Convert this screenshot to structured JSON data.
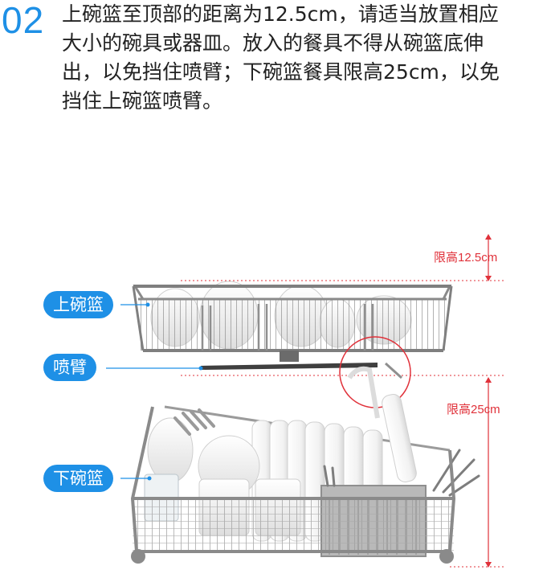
{
  "step": {
    "number": "02",
    "text_lines": [
      "上碗篮至顶部的距离为12.5cm，请适当放置相应",
      "大小的碗具或器皿。放入的餐具不得从碗篮底伸",
      "出，以免挡住喷臂；下碗篮餐具限高25cm，以免",
      "挡住上碗篮喷臂。"
    ]
  },
  "labels": {
    "upper_rack": "上碗篮",
    "spray_arm": "喷臂",
    "lower_rack": "下碗篮"
  },
  "height_limits": {
    "upper": "限高12.5cm",
    "lower": "限高25cm"
  },
  "colors": {
    "accent_blue": "#1e90e6",
    "limit_red": "#e0313a",
    "rack_gray": "#9a9a9a",
    "text": "#222222"
  }
}
